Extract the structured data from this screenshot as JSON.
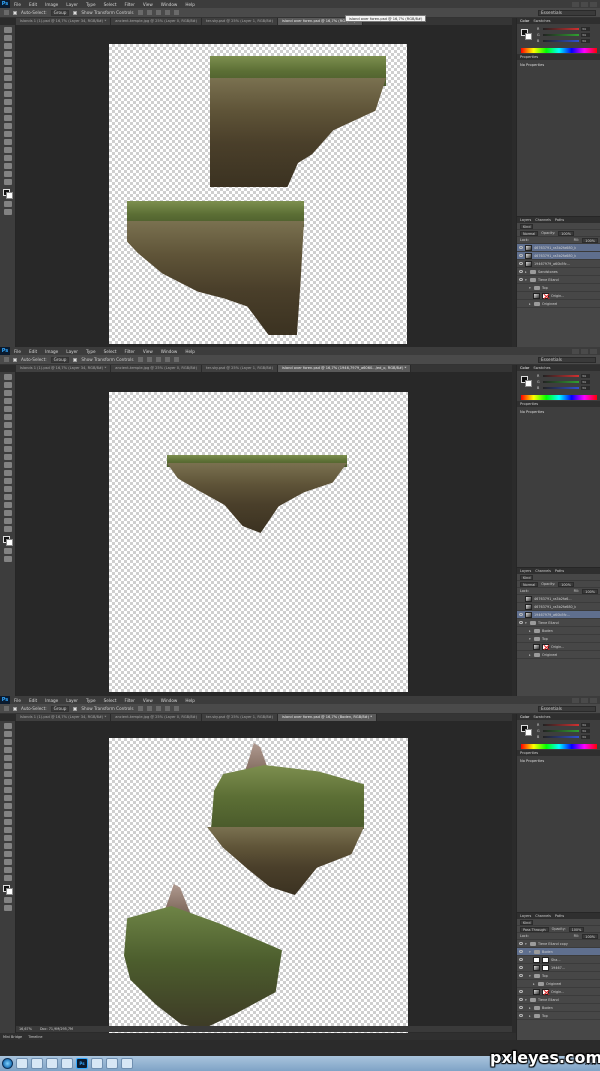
{
  "menus": [
    "File",
    "Edit",
    "Image",
    "Layer",
    "Type",
    "Select",
    "Filter",
    "View",
    "Window",
    "Help"
  ],
  "ps_logo": "Ps",
  "options": {
    "auto_select": "Auto-Select:",
    "group": "Group",
    "show_transform": "Show Transform Controls",
    "workspace": "Essentials"
  },
  "frames": [
    {
      "tabs": [
        "Islands 1 (1).psd @ 16,7% (Layer 34, RGB/8#) *",
        "ancient-temple.jpg @ 25% (Layer 0, RGB/8#)",
        "ter-sky.psd @ 25% (Layer 1, RGB/8#)",
        "island over foren.psd @ 16,7% (RGB/8#) *"
      ],
      "active_tab": 3,
      "tooltip": "island over foren.psd @ 16,7% (RGB/8#)",
      "properties": "No Properties",
      "layers": {
        "blend": "Normal",
        "opacity_label": "Opacity:",
        "opacity": "100%",
        "lock_label": "Lock:",
        "fill_label": "Fill:",
        "fill": "100%",
        "rows": [
          {
            "name": "46763791_ra3b2fa680_b",
            "type": "thumb",
            "indent": 0,
            "selected": true
          },
          {
            "name": "46763791_ra3b2fa680_b",
            "type": "thumb",
            "indent": 0,
            "selected": true
          },
          {
            "name": "19467979_a60b5fc...",
            "type": "thumb",
            "indent": 0,
            "selected": false
          },
          {
            "name": "Sandstones",
            "type": "folder",
            "indent": 0,
            "selected": false
          },
          {
            "name": "Tiene Eiland",
            "type": "folder",
            "indent": 0,
            "selected": false
          },
          {
            "name": "Top",
            "type": "folder",
            "indent": 1,
            "selected": false
          },
          {
            "name": "Origin...",
            "type": "masked",
            "indent": 2,
            "selected": false
          },
          {
            "name": "Origineel",
            "type": "folder",
            "indent": 1,
            "selected": false
          }
        ]
      }
    },
    {
      "tabs": [
        "Islands 1 (1).psd @ 16,7% (Layer 34, RGB/8#) *",
        "ancient-temple.jpg @ 25% (Layer 0, RGB/8#)",
        "ter-sky.psd @ 25% (Layer 1, RGB/8#)",
        "island over foren.psd @ 16,7% (1946,7979_a6060.../ed_o, RGB/8#) *"
      ],
      "active_tab": 3,
      "properties": "No Properties",
      "layers": {
        "blend": "Normal",
        "opacity_label": "Opacity:",
        "opacity": "100%",
        "lock_label": "Lock:",
        "fill_label": "Fill:",
        "fill": "100%",
        "rows": [
          {
            "name": "46763791_ra3b2fa6...",
            "type": "thumb",
            "indent": 0,
            "selected": false
          },
          {
            "name": "46763791_ra3b2fa680_b",
            "type": "thumb",
            "indent": 0,
            "selected": false
          },
          {
            "name": "19467979_a60b5fc...",
            "type": "thumb",
            "indent": 0,
            "selected": true
          },
          {
            "name": "Tiene Eiland",
            "type": "folder",
            "indent": 0,
            "selected": false
          },
          {
            "name": "Boden",
            "type": "folder",
            "indent": 1,
            "selected": false
          },
          {
            "name": "Top",
            "type": "folder",
            "indent": 1,
            "selected": false
          },
          {
            "name": "Origin...",
            "type": "masked",
            "indent": 2,
            "selected": false
          },
          {
            "name": "Origineel",
            "type": "folder",
            "indent": 1,
            "selected": false
          }
        ]
      }
    },
    {
      "tabs": [
        "Islands 1 (1).psd @ 16,7% (Layer 34, RGB/8#) *",
        "ancient-temple.jpg @ 25% (Layer 0, RGB/8#)",
        "ter-sky.psd @ 25% (Layer 1, RGB/8#)",
        "island over foren.psd @ 16,7% (Boden, RGB/8#) *"
      ],
      "active_tab": 3,
      "properties": "No Properties",
      "layers": {
        "blend": "Pass Through",
        "opacity_label": "Opacity:",
        "opacity": "100%",
        "lock_label": "Lock:",
        "fill_label": "Fill:",
        "fill": "100%",
        "rows": [
          {
            "name": "Tiene Eiland copy",
            "type": "folder",
            "indent": 0,
            "selected": false
          },
          {
            "name": "Boden",
            "type": "folder",
            "indent": 1,
            "selected": true
          },
          {
            "name": "Sha...",
            "type": "masked2",
            "indent": 2,
            "selected": false
          },
          {
            "name": "19467...",
            "type": "masked2",
            "indent": 2,
            "selected": false
          },
          {
            "name": "Top",
            "type": "folder",
            "indent": 1,
            "selected": false
          },
          {
            "name": "Origineel",
            "type": "folder",
            "indent": 2,
            "selected": false
          },
          {
            "name": "Origin...",
            "type": "masked",
            "indent": 2,
            "selected": false
          },
          {
            "name": "Tiene Eiland",
            "type": "folder",
            "indent": 0,
            "selected": false
          },
          {
            "name": "Boden",
            "type": "folder",
            "indent": 1,
            "selected": false
          },
          {
            "name": "Top",
            "type": "folder",
            "indent": 1,
            "selected": false
          }
        ]
      },
      "status": {
        "zoom": "16,67%",
        "doc": "Doc: 71,9M/295,7M"
      },
      "minibridge": [
        "Mini Bridge",
        "Timeline"
      ]
    }
  ],
  "panels": {
    "color_tab": "Color",
    "swatches_tab": "Swatches",
    "properties_tab": "Properties",
    "layers_tab": "Layers",
    "channels_tab": "Channels",
    "paths_tab": "Paths",
    "kind": "Kind",
    "sliders": [
      {
        "letter": "R",
        "value": "34",
        "color": "#d03030"
      },
      {
        "letter": "G",
        "value": "34",
        "color": "#30a030"
      },
      {
        "letter": "B",
        "value": "34",
        "color": "#3050d0"
      }
    ]
  },
  "taskbar": {
    "ps_icon": "Ps",
    "time": "14:35"
  },
  "watermark": "pxleyes.com"
}
